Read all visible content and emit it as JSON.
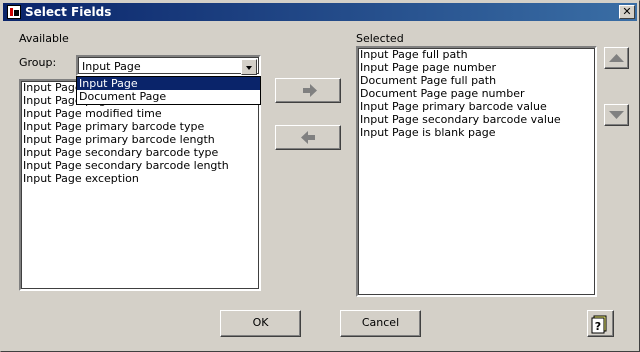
{
  "window": {
    "title": "Select Fields",
    "close_glyph": "✕"
  },
  "available": {
    "label": "Available",
    "group_label": "Group:",
    "group_value": "Input Page",
    "group_options": [
      "Input Page",
      "Document Page"
    ],
    "items": [
      "Input Page full path",
      "Input Page page number",
      "Input Page modified time",
      "Input Page primary barcode type",
      "Input Page primary barcode length",
      "Input Page secondary barcode type",
      "Input Page secondary barcode length",
      "Input Page exception"
    ]
  },
  "selected": {
    "label": "Selected",
    "items": [
      "Input Page full path",
      "Input Page page number",
      "Document Page full path",
      "Document Page page number",
      "Input Page primary barcode value",
      "Input Page secondary barcode value",
      "Input Page is blank page"
    ]
  },
  "buttons": {
    "ok": "OK",
    "cancel": "Cancel"
  },
  "icons": {
    "add": "arrow-right-icon",
    "remove": "arrow-left-icon",
    "move_up": "triangle-up-icon",
    "move_down": "triangle-down-icon",
    "help": "help-icon",
    "accent": "#0a246a",
    "arrow_color": "#808080"
  }
}
